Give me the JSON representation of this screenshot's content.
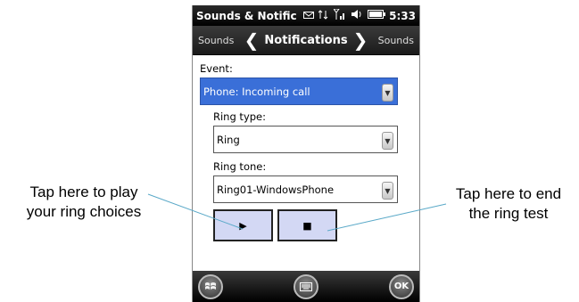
{
  "callouts": {
    "left_line1": "Tap here to play",
    "left_line2": "your ring choices",
    "right_line1": "Tap here to end",
    "right_line2": "the ring test"
  },
  "status_bar": {
    "title": "Sounds & Notificat",
    "time": "5:33",
    "icons": [
      "messaging-icon",
      "data-sync-icon",
      "signal-strength-icon",
      "speaker-icon",
      "battery-icon"
    ]
  },
  "nav": {
    "prev_label": "Sounds",
    "title": "Notifications",
    "next_label": "Sounds"
  },
  "form": {
    "event_label": "Event:",
    "event_value": "Phone: Incoming call",
    "ring_type_label": "Ring type:",
    "ring_type_value": "Ring",
    "ring_tone_label": "Ring tone:",
    "ring_tone_value": "Ring01-WindowsPhone",
    "play_glyph": "▶",
    "stop_glyph": "■"
  },
  "bottom_bar": {
    "start_icon": "windows-flag-icon",
    "keyboard_icon": "keyboard-icon",
    "ok_label": "OK"
  },
  "colors": {
    "selected_field": "#3a6fd8",
    "button_fill": "#d3d8f4"
  }
}
